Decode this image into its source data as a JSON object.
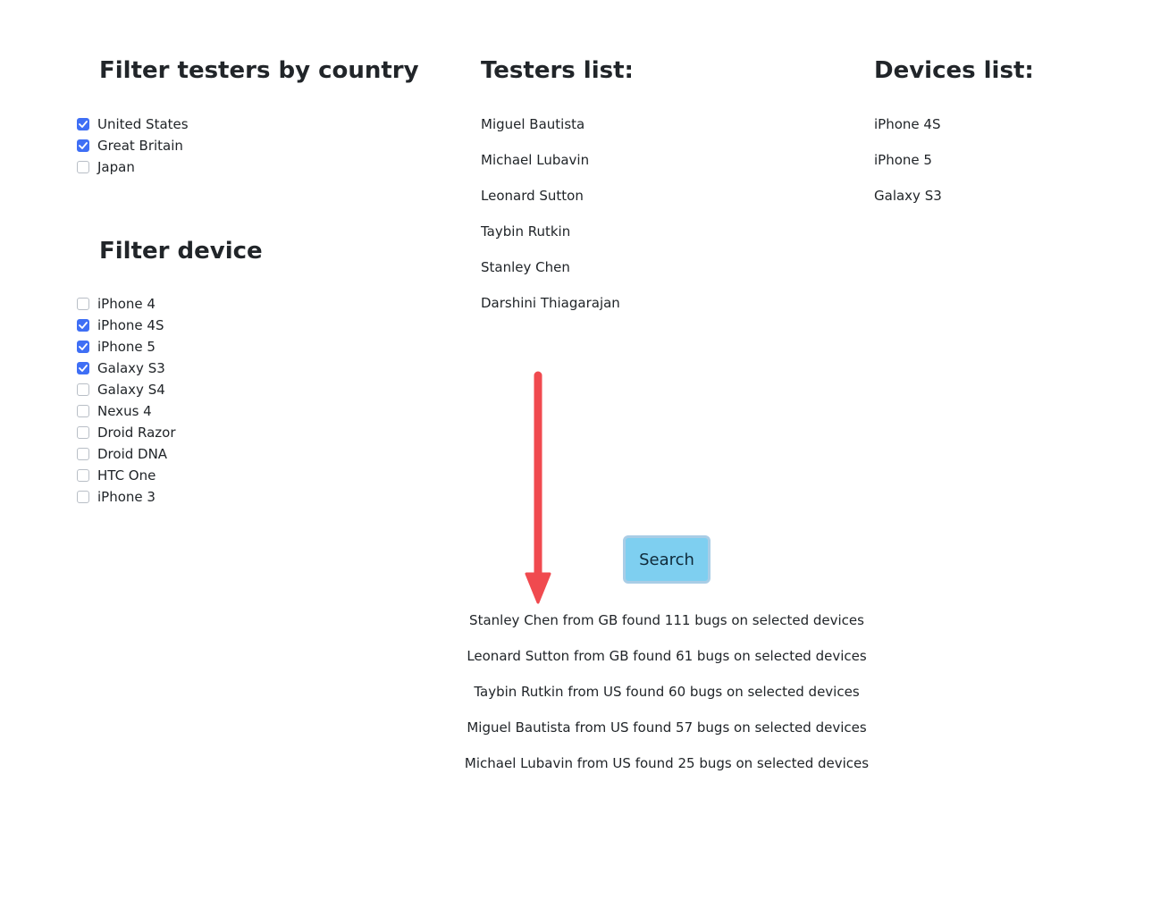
{
  "country_filter": {
    "title": "Filter testers by country",
    "options": [
      {
        "label": "United States",
        "checked": true
      },
      {
        "label": "Great Britain",
        "checked": true
      },
      {
        "label": "Japan",
        "checked": false
      }
    ]
  },
  "device_filter": {
    "title": "Filter device",
    "options": [
      {
        "label": "iPhone 4",
        "checked": false
      },
      {
        "label": "iPhone 4S",
        "checked": true
      },
      {
        "label": "iPhone 5",
        "checked": true
      },
      {
        "label": "Galaxy S3",
        "checked": true
      },
      {
        "label": "Galaxy S4",
        "checked": false
      },
      {
        "label": "Nexus 4",
        "checked": false
      },
      {
        "label": "Droid Razor",
        "checked": false
      },
      {
        "label": "Droid DNA",
        "checked": false
      },
      {
        "label": "HTC One",
        "checked": false
      },
      {
        "label": "iPhone 3",
        "checked": false
      }
    ]
  },
  "testers": {
    "title": "Testers list:",
    "items": [
      "Miguel Bautista",
      "Michael Lubavin",
      "Leonard Sutton",
      "Taybin Rutkin",
      "Stanley Chen",
      "Darshini Thiagarajan"
    ]
  },
  "devices": {
    "title": "Devices list:",
    "items": [
      "iPhone 4S",
      "iPhone 5",
      "Galaxy S3"
    ]
  },
  "search": {
    "label": "Search"
  },
  "results": [
    "Stanley Chen from GB found 111 bugs on selected devices",
    "Leonard Sutton from GB found 61 bugs on selected devices",
    "Taybin Rutkin from US found 60 bugs on selected devices",
    "Miguel Bautista from US found 57 bugs on selected devices",
    "Michael Lubavin from US found 25 bugs on selected devices"
  ],
  "colors": {
    "checkbox_checked": "#3f6ff5",
    "search_button": "#7ecff0",
    "annotation_arrow": "#f04a4f"
  },
  "icons": {
    "annotation": "red-down-arrow-icon",
    "check": "check-icon"
  }
}
